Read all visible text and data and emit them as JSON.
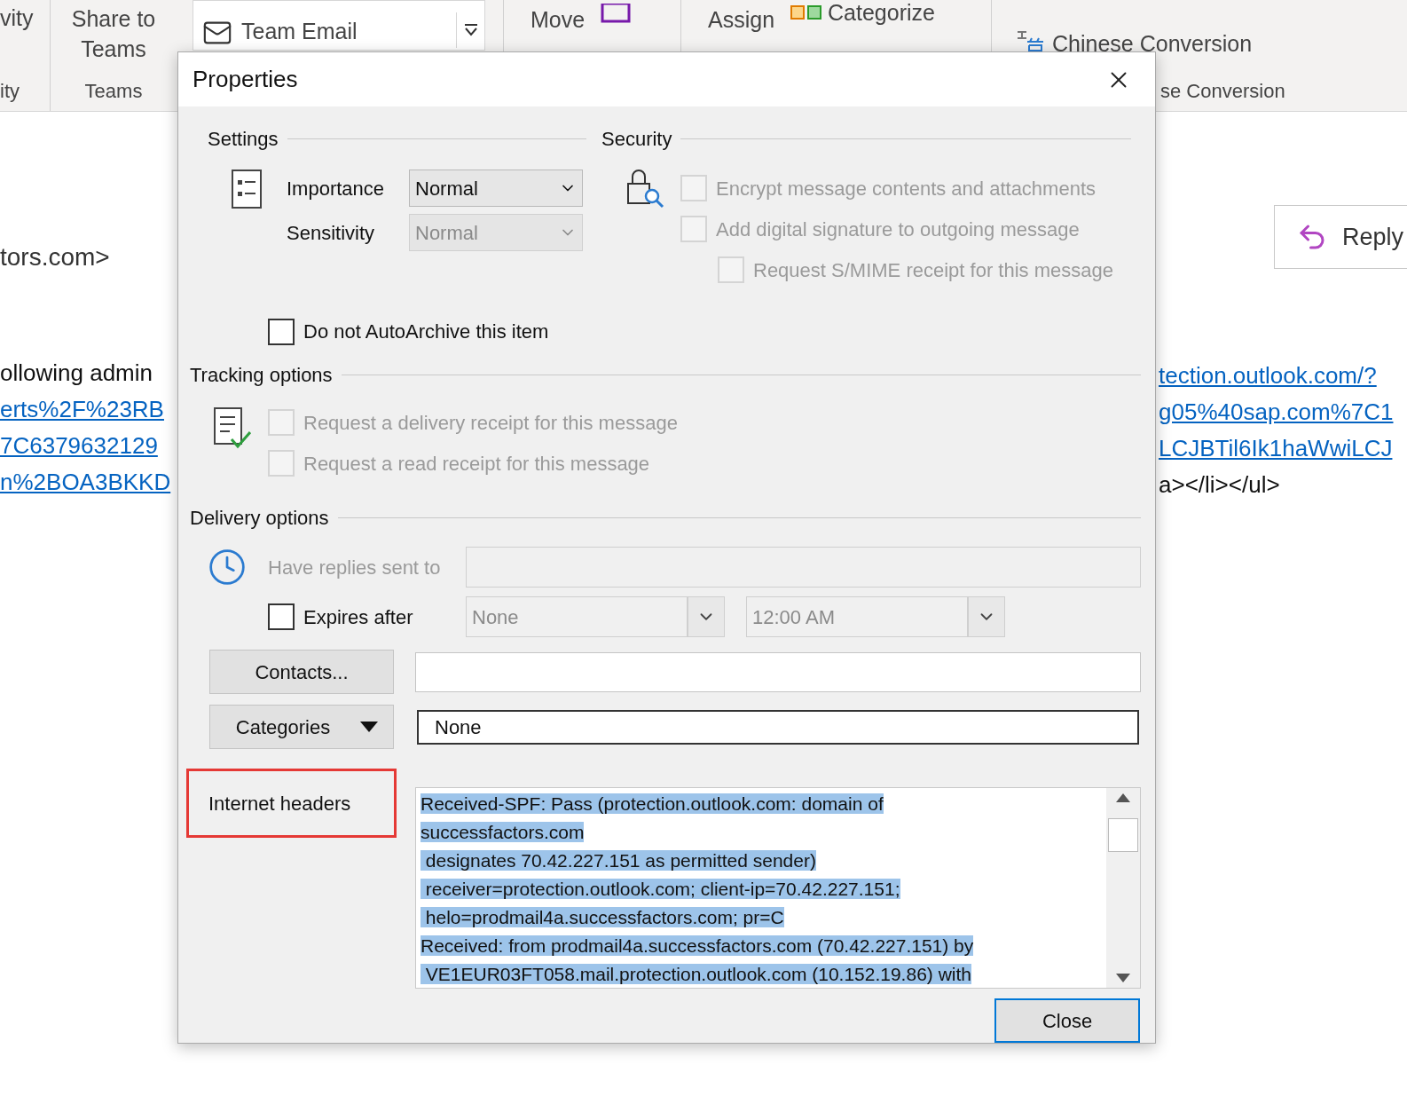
{
  "ribbon": {
    "cut_label": "vity",
    "cut_group": "ity",
    "share": "Share to Teams",
    "teams_group": "Teams",
    "quick_step": "Team Email",
    "move": "Move",
    "assign": "Assign",
    "categorize": "Categorize",
    "chinese": "Chinese Conversion",
    "chinese_group": "se Conversion"
  },
  "email": {
    "sender": "tors.com>",
    "left_body": [
      {
        "text": "ollowing admin",
        "kind": "text"
      },
      {
        "text": "erts%2F%23RB",
        "kind": "link"
      },
      {
        "text": "7C6379632129",
        "kind": "link"
      },
      {
        "text": "n%2BOA3BKKD",
        "kind": "link"
      }
    ],
    "right_body": [
      {
        "text": "tection.outlook.com/?",
        "kind": "link"
      },
      {
        "text": "g05%40sap.com%7C1",
        "kind": "link"
      },
      {
        "text": "LCJBTil6Ik1haWwiLCJ",
        "kind": "link"
      },
      {
        "text": "a></li></ul>",
        "kind": "text"
      }
    ],
    "reply": "Reply"
  },
  "dialog": {
    "title": "Properties",
    "settings": {
      "heading": "Settings",
      "importance": {
        "label": "Importance",
        "value": "Normal",
        "disabled": false
      },
      "sensitivity": {
        "label": "Sensitivity",
        "value": "Normal",
        "disabled": true
      }
    },
    "security": {
      "heading": "Security",
      "options": [
        {
          "label": "Encrypt message contents and attachments",
          "checked": false,
          "disabled": true,
          "kind": "main"
        },
        {
          "label": "Add digital signature to outgoing message",
          "checked": false,
          "disabled": true,
          "kind": "main"
        },
        {
          "label": "Request S/MIME receipt for this message",
          "checked": false,
          "disabled": true,
          "kind": "sub"
        }
      ]
    },
    "autoarchive": {
      "label": "Do not AutoArchive this item",
      "checked": false,
      "disabled": false
    },
    "tracking": {
      "heading": "Tracking options",
      "options": [
        {
          "label": "Request a delivery receipt for this message",
          "checked": false,
          "disabled": true
        },
        {
          "label": "Request a read receipt for this message",
          "checked": false,
          "disabled": true
        }
      ]
    },
    "delivery": {
      "heading": "Delivery options",
      "replies": {
        "label": "Have replies sent to",
        "disabled": true
      },
      "expires": {
        "label": "Expires after",
        "checked": false,
        "disabled": false
      },
      "date": {
        "value": "None",
        "disabled": true
      },
      "time": {
        "value": "12:00 AM",
        "disabled": true
      }
    },
    "contacts": {
      "button": "Contacts..."
    },
    "categories": {
      "button": "Categories",
      "value": "None"
    },
    "internet_headers": {
      "label": "Internet headers",
      "highlighted": true,
      "selected": true,
      "lines": [
        "Received-SPF: Pass (protection.outlook.com: domain of",
        "successfactors.com",
        " designates 70.42.227.151 as permitted sender)",
        " receiver=protection.outlook.com; client-ip=70.42.227.151;",
        " helo=prodmail4a.successfactors.com; pr=C",
        "Received: from prodmail4a.successfactors.com (70.42.227.151) by",
        " VE1EUR03FT058.mail.protection.outlook.com (10.152.19.86) with"
      ]
    },
    "close_button": {
      "label": "Close",
      "default": true
    }
  }
}
